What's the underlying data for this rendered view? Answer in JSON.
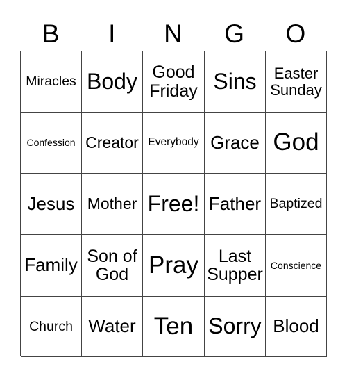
{
  "header": [
    "B",
    "I",
    "N",
    "G",
    "O"
  ],
  "cells": [
    [
      {
        "text": "Miracles",
        "size": "m"
      },
      {
        "text": "Body",
        "size": "xl"
      },
      {
        "text": "Good\nFriday",
        "size": "l2"
      },
      {
        "text": "Sins",
        "size": "xl"
      },
      {
        "text": "Easter\nSunday",
        "size": "m2"
      }
    ],
    [
      {
        "text": "Confession",
        "size": "xs"
      },
      {
        "text": "Creator",
        "size": "ml"
      },
      {
        "text": "Everybody",
        "size": "s"
      },
      {
        "text": "Grace",
        "size": "l"
      },
      {
        "text": "God",
        "size": "xxl"
      }
    ],
    [
      {
        "text": "Jesus",
        "size": "l"
      },
      {
        "text": "Mother",
        "size": "ml"
      },
      {
        "text": "Free!",
        "size": "xl"
      },
      {
        "text": "Father",
        "size": "l"
      },
      {
        "text": "Baptized",
        "size": "m"
      }
    ],
    [
      {
        "text": "Family",
        "size": "l"
      },
      {
        "text": "Son of\nGod",
        "size": "l2"
      },
      {
        "text": "Pray",
        "size": "xxl"
      },
      {
        "text": "Last\nSupper",
        "size": "l2"
      },
      {
        "text": "Conscience",
        "size": "xs"
      }
    ],
    [
      {
        "text": "Church",
        "size": "m"
      },
      {
        "text": "Water",
        "size": "l"
      },
      {
        "text": "Ten",
        "size": "xxl"
      },
      {
        "text": "Sorry",
        "size": "xl"
      },
      {
        "text": "Blood",
        "size": "l"
      }
    ]
  ]
}
